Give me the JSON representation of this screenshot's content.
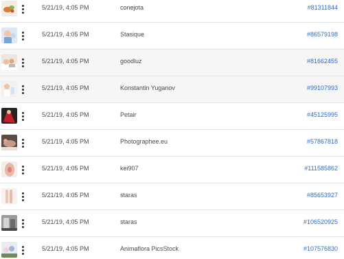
{
  "rows": [
    {
      "thumb": "vegetables-food-photo",
      "date": "5/21/19, 4:05 PM",
      "author": "conejota",
      "id": "#81311844"
    },
    {
      "thumb": "child-portrait-photo",
      "date": "5/21/19, 4:05 PM",
      "author": "Stasique",
      "id": "#86579198"
    },
    {
      "thumb": "family-bedroom-photo",
      "date": "5/21/19, 4:05 PM",
      "author": "goodluz",
      "id": "#81662455"
    },
    {
      "thumb": "woman-lotion-photo",
      "date": "5/21/19, 4:05 PM",
      "author": "Konstantin Yuganov",
      "id": "#99107993"
    },
    {
      "thumb": "red-dress-photo",
      "date": "5/21/19, 4:05 PM",
      "author": "Petair",
      "id": "#45125995"
    },
    {
      "thumb": "person-lying-photo",
      "date": "5/21/19, 4:05 PM",
      "author": "Photographee.eu",
      "id": "#57867818"
    },
    {
      "thumb": "back-skin-photo",
      "date": "5/21/19, 4:05 PM",
      "author": "kei907",
      "id": "#111585862"
    },
    {
      "thumb": "legs-photo",
      "date": "5/21/19, 4:05 PM",
      "author": "staras",
      "id": "#85653927"
    },
    {
      "thumb": "grayscale-room-photo",
      "date": "5/21/19, 4:05 PM",
      "author": "staras",
      "id": "#106520925"
    },
    {
      "thumb": "flowers-photo",
      "date": "5/21/19, 4:05 PM",
      "author": "Animaflora PicsStock",
      "id": "#107576830"
    }
  ]
}
